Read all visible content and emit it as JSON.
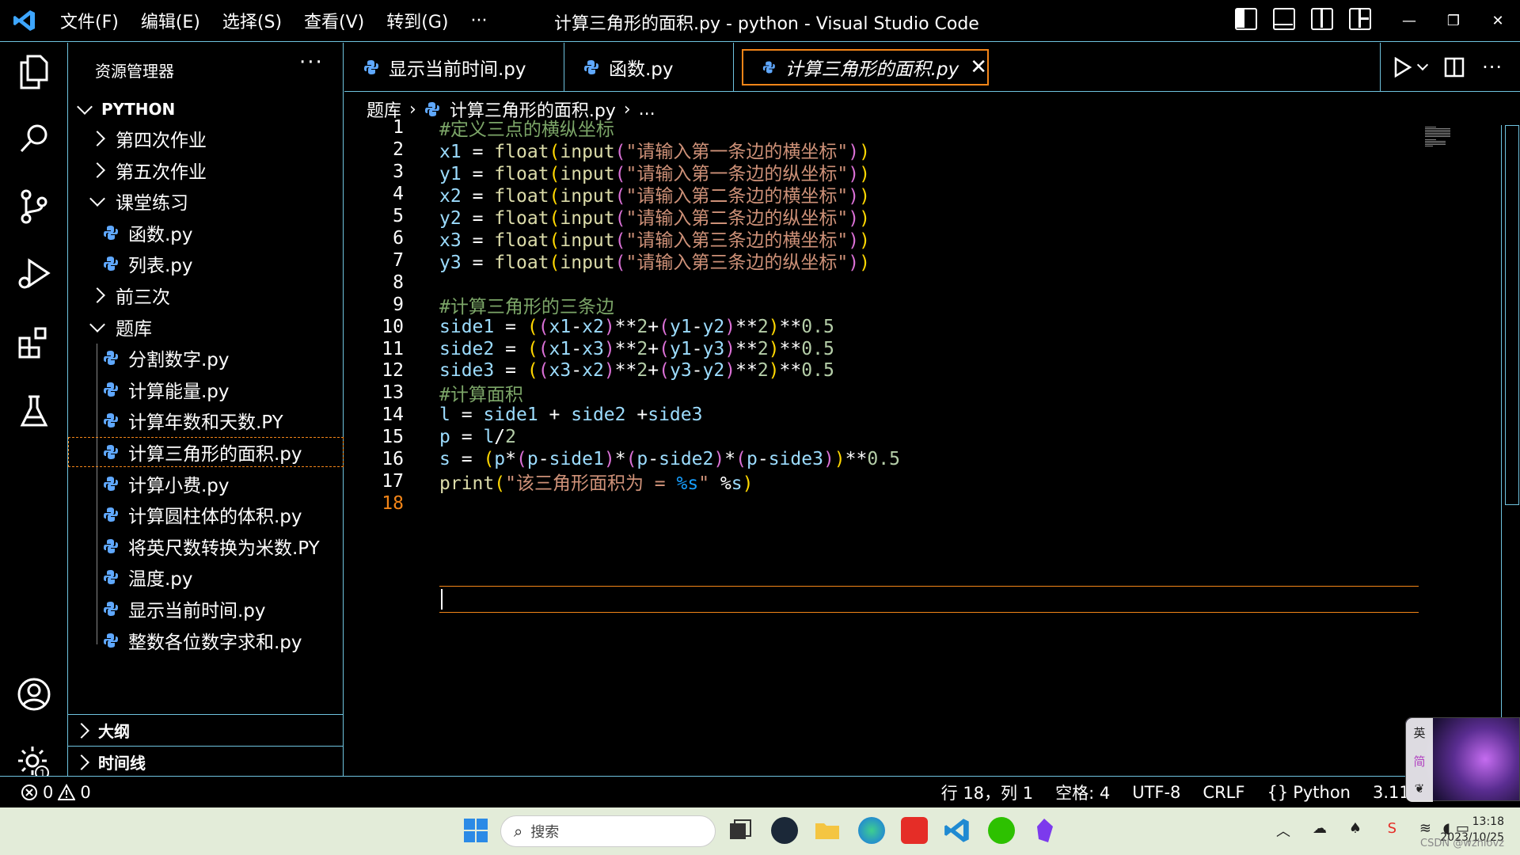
{
  "titlebar": {
    "menus": [
      "文件(F)",
      "编辑(E)",
      "选择(S)",
      "查看(V)",
      "转到(G)",
      "···"
    ],
    "window_title": "计算三角形的面积.py - python - Visual Studio Code",
    "controls": [
      "—",
      "❐",
      "✕"
    ]
  },
  "sidebar": {
    "header": "资源管理器",
    "more": "···",
    "workspace": "PYTHON",
    "tree": [
      {
        "label": "第四次作业",
        "kind": "folder-closed",
        "level": 1
      },
      {
        "label": "第五次作业",
        "kind": "folder-closed",
        "level": 1
      },
      {
        "label": "课堂练习",
        "kind": "folder-open",
        "level": 1
      },
      {
        "label": "函数.py",
        "kind": "file",
        "level": 2
      },
      {
        "label": "列表.py",
        "kind": "file",
        "level": 2
      },
      {
        "label": "前三次",
        "kind": "folder-closed",
        "level": 1
      },
      {
        "label": "题库",
        "kind": "folder-open",
        "level": 1
      },
      {
        "label": "分割数字.py",
        "kind": "file",
        "level": 2
      },
      {
        "label": "计算能量.py",
        "kind": "file",
        "level": 2
      },
      {
        "label": "计算年数和天数.PY",
        "kind": "file",
        "level": 2
      },
      {
        "label": "计算三角形的面积.py",
        "kind": "file",
        "level": 2,
        "selected": true
      },
      {
        "label": "计算小费.py",
        "kind": "file",
        "level": 2
      },
      {
        "label": "计算圆柱体的体积.py",
        "kind": "file",
        "level": 2
      },
      {
        "label": "将英尺数转换为米数.PY",
        "kind": "file",
        "level": 2
      },
      {
        "label": "温度.py",
        "kind": "file",
        "level": 2
      },
      {
        "label": "显示当前时间.py",
        "kind": "file",
        "level": 2
      },
      {
        "label": "整数各位数字求和.py",
        "kind": "file",
        "level": 2
      }
    ],
    "outline": "大纲",
    "timeline": "时间线"
  },
  "tabs": [
    {
      "label": "显示当前时间.py",
      "active": false
    },
    {
      "label": "函数.py",
      "active": false
    },
    {
      "label": "计算三角形的面积.py",
      "active": true
    }
  ],
  "breadcrumb": {
    "folder": "题库",
    "file": "计算三角形的面积.py",
    "tail": "..."
  },
  "editor": {
    "current_line": 18,
    "lines": [
      "#定义三点的横纵坐标",
      "x1 = float(input(\"请输入第一条边的横坐标\"))",
      "y1 = float(input(\"请输入第一条边的纵坐标\"))",
      "x2 = float(input(\"请输入第二条边的横坐标\"))",
      "y2 = float(input(\"请输入第二条边的纵坐标\"))",
      "x3 = float(input(\"请输入第三条边的横坐标\"))",
      "y3 = float(input(\"请输入第三条边的纵坐标\"))",
      "",
      "#计算三角形的三条边",
      "side1 = ((x1-x2)**2+(y1-y2)**2)**0.5",
      "side2 = ((x1-x3)**2+(y1-y3)**2)**0.5",
      "side3 = ((x3-x2)**2+(y3-y2)**2)**0.5",
      "#计算面积",
      "l = side1 + side2 +side3",
      "p = l/2",
      "s = (p*(p-side1)*(p-side2)*(p-side3))**0.5",
      "print(\"该三角形面积为 = %s\" %s)",
      ""
    ]
  },
  "statusbar": {
    "errors": "0",
    "warnings": "0",
    "position": "行 18，列 1",
    "spaces": "空格: 4",
    "encoding": "UTF-8",
    "eol": "CRLF",
    "language": "Python",
    "interpreter": "3.11.5 64-bi"
  },
  "ime": {
    "lang": "英",
    "mode": "简"
  },
  "taskbar": {
    "search_placeholder": "搜索",
    "time": "13:18",
    "date": "2023/10/25",
    "watermark": "CSDN @wzhlovz"
  },
  "colors": {
    "accent": "#f38518",
    "border": "#6fc3df",
    "comment": "#7ca668",
    "variable": "#9cdcfe",
    "function": "#dcdcaa",
    "string": "#ce9178",
    "number": "#b5cea8"
  }
}
